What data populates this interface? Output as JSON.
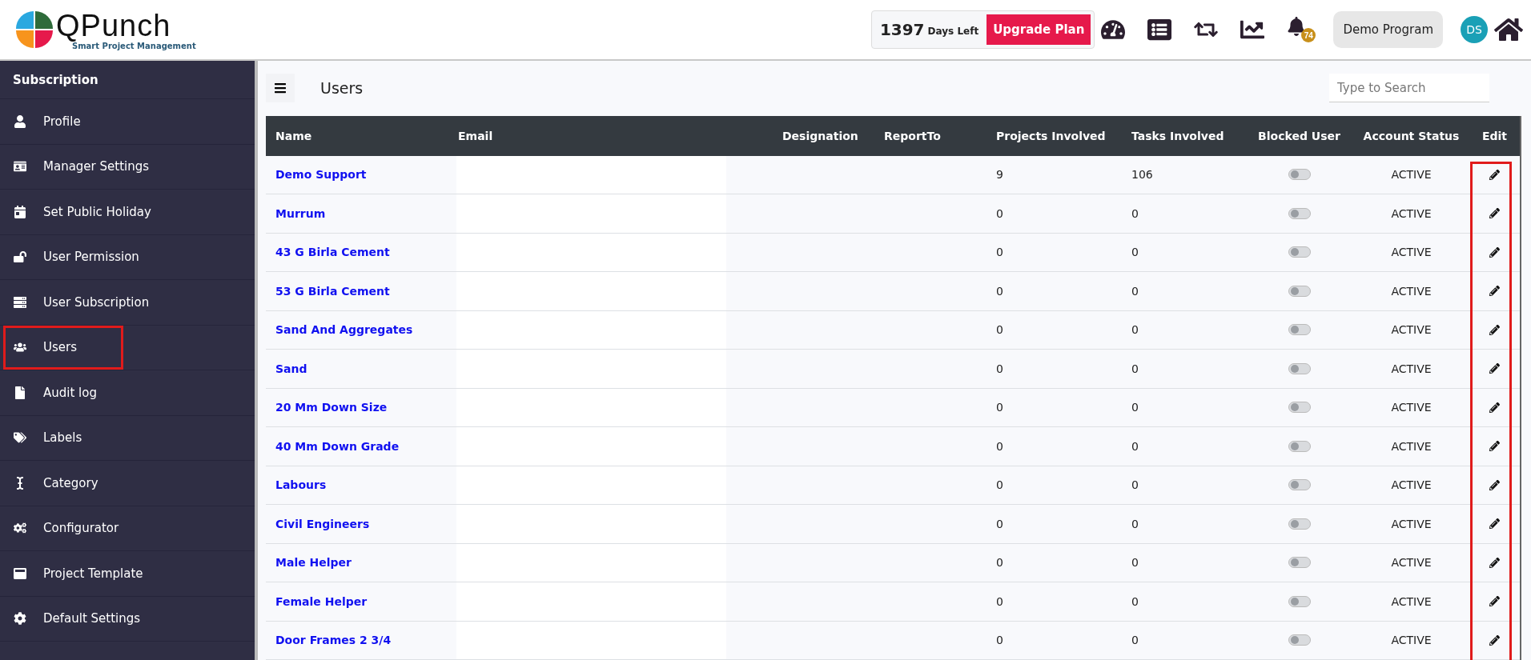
{
  "header": {
    "logo": {
      "name": "QPunch",
      "tagline": "Smart Project Management"
    },
    "days_left": {
      "count": "1397",
      "label": "Days Left"
    },
    "upgrade_button": "Upgrade Plan",
    "notifications": "74",
    "program_button": "Demo Program",
    "avatar": "DS"
  },
  "sidebar": {
    "section": "Subscription",
    "items": [
      {
        "label": "Profile",
        "highlighted": false
      },
      {
        "label": "Manager Settings",
        "highlighted": false
      },
      {
        "label": "Set Public Holiday",
        "highlighted": false
      },
      {
        "label": "User Permission",
        "highlighted": false
      },
      {
        "label": "User Subscription",
        "highlighted": false
      },
      {
        "label": "Users",
        "highlighted": true
      },
      {
        "label": "Audit log",
        "highlighted": false
      },
      {
        "label": "Labels",
        "highlighted": false
      },
      {
        "label": "Category",
        "highlighted": false
      },
      {
        "label": "Configurator",
        "highlighted": false
      },
      {
        "label": "Project Template",
        "highlighted": false
      },
      {
        "label": "Default Settings",
        "highlighted": false
      }
    ]
  },
  "page": {
    "title": "Users",
    "search": {
      "placeholder": "Type to Search"
    }
  },
  "table": {
    "edit_column_highlighted": true,
    "columns": [
      "Name",
      "Email",
      "Designation",
      "ReportTo",
      "Projects Involved",
      "Tasks Involved",
      "Blocked User",
      "Account Status",
      "Edit"
    ],
    "rows": [
      {
        "name": "Demo Support",
        "projects": "9",
        "tasks": "106",
        "blocked": false,
        "status": "ACTIVE"
      },
      {
        "name": "Murrum",
        "projects": "0",
        "tasks": "0",
        "blocked": false,
        "status": "ACTIVE"
      },
      {
        "name": "43 G Birla Cement",
        "projects": "0",
        "tasks": "0",
        "blocked": false,
        "status": "ACTIVE"
      },
      {
        "name": "53 G Birla Cement",
        "projects": "0",
        "tasks": "0",
        "blocked": false,
        "status": "ACTIVE"
      },
      {
        "name": "Sand And Aggregates",
        "projects": "0",
        "tasks": "0",
        "blocked": false,
        "status": "ACTIVE"
      },
      {
        "name": "Sand",
        "projects": "0",
        "tasks": "0",
        "blocked": false,
        "status": "ACTIVE"
      },
      {
        "name": "20 Mm Down Size",
        "projects": "0",
        "tasks": "0",
        "blocked": false,
        "status": "ACTIVE"
      },
      {
        "name": "40 Mm Down Grade",
        "projects": "0",
        "tasks": "0",
        "blocked": false,
        "status": "ACTIVE"
      },
      {
        "name": "Labours",
        "projects": "0",
        "tasks": "0",
        "blocked": false,
        "status": "ACTIVE"
      },
      {
        "name": "Civil Engineers",
        "projects": "0",
        "tasks": "0",
        "blocked": false,
        "status": "ACTIVE"
      },
      {
        "name": "Male Helper",
        "projects": "0",
        "tasks": "0",
        "blocked": false,
        "status": "ACTIVE"
      },
      {
        "name": "Female Helper",
        "projects": "0",
        "tasks": "0",
        "blocked": false,
        "status": "ACTIVE"
      },
      {
        "name": "Door Frames 2 3/4",
        "projects": "0",
        "tasks": "0",
        "blocked": false,
        "status": "ACTIVE"
      }
    ]
  }
}
